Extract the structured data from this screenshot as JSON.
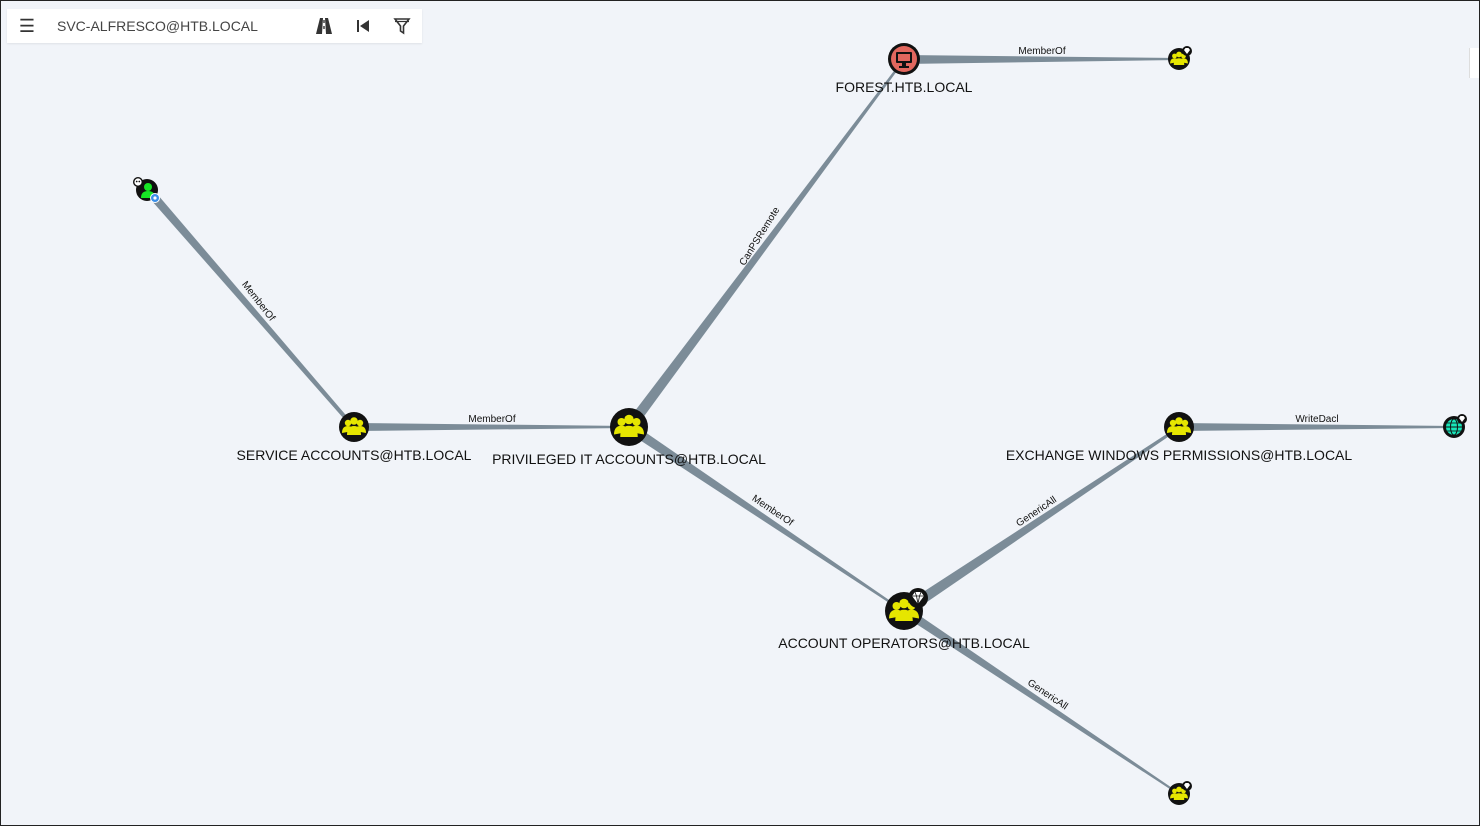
{
  "toolbar": {
    "menu_icon": "hamburger-menu-icon",
    "search_value": "SVC-ALFRESCO@HTB.LOCAL",
    "pathfinding_icon": "road-icon",
    "back_icon": "skip-back-icon",
    "filter_icon": "filter-icon"
  },
  "colors": {
    "background": "#f1f4f9",
    "edge": "#7c8c98",
    "group_fill": "#e6e600",
    "computer_fill": "#e2675e",
    "user_fill": "#17e625",
    "domain_fill": "#17e6b9"
  },
  "nodes": {
    "svc_user": {
      "label": ""
    },
    "service_accounts": {
      "label": "SERVICE ACCOUNTS@HTB.LOCAL"
    },
    "privileged_it": {
      "label": "PRIVILEGED IT ACCOUNTS@HTB.LOCAL"
    },
    "forest": {
      "label": "FOREST.HTB.LOCAL"
    },
    "forest_group": {
      "label": ""
    },
    "exchange_windows": {
      "label": "EXCHANGE WINDOWS PERMISSIONS@HTB.LOCAL"
    },
    "domain": {
      "label": ""
    },
    "account_operators": {
      "label": "ACCOUNT OPERATORS@HTB.LOCAL"
    },
    "bottom_group": {
      "label": ""
    }
  },
  "edges": {
    "svc_memberof": "MemberOf",
    "service_memberof": "MemberOf",
    "canpsremote": "CanPSRemote",
    "forest_memberof": "MemberOf",
    "privileged_memberof": "MemberOf",
    "genericall_exchange": "GenericAll",
    "writedacl": "WriteDacl",
    "genericall_bottom": "GenericAll"
  }
}
